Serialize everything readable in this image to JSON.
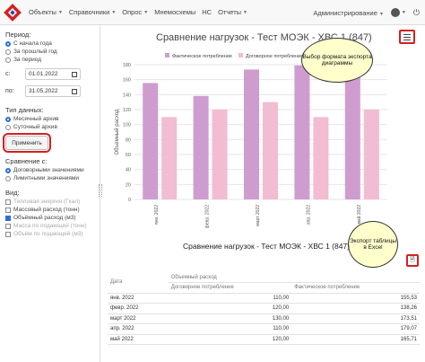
{
  "nav": {
    "items": [
      {
        "label": "Объекты",
        "caret": true
      },
      {
        "label": "Справочники",
        "caret": true
      },
      {
        "label": "Опрос",
        "caret": true
      },
      {
        "label": "Мнемосхемы",
        "caret": false
      },
      {
        "label": "НС",
        "caret": false
      },
      {
        "label": "Отчеты",
        "caret": true
      }
    ],
    "admin_label": "Администрирование"
  },
  "sidebar": {
    "period_title": "Период:",
    "period_options": [
      "С начала года",
      "За прошлый год",
      "За период"
    ],
    "period_selected": 0,
    "from_label": "с:",
    "from_value": "01.01.2022",
    "to_label": "по:",
    "to_value": "31.05.2022",
    "data_type_title": "Тип данных:",
    "data_type_options": [
      "Месячный архив",
      "Суточный архив"
    ],
    "data_type_selected": 0,
    "apply_label": "Применить",
    "compare_title": "Сравнение с:",
    "compare_options": [
      "Договорными значениями",
      "Лимитными значениями"
    ],
    "compare_selected": 0,
    "view_title": "Вид:",
    "view_options": [
      {
        "label": "Тепловая энергия (Гкал)",
        "checked": false,
        "disabled": true
      },
      {
        "label": "Массовый расход (тонн)",
        "checked": false,
        "disabled": false
      },
      {
        "label": "Объёмный расход (м3)",
        "checked": true,
        "disabled": false
      },
      {
        "label": "Масса по подающей (тонн)",
        "checked": false,
        "disabled": true
      },
      {
        "label": "Объём по подающей (м3)",
        "checked": false,
        "disabled": true
      }
    ]
  },
  "chart": {
    "title": "Сравнение нагрузок - Тест МОЭК - ХВС 1 (847)",
    "callout_menu": "Выбор формата экспорта диаграммы",
    "callout_excel": "Экспорт таблицы в Excel",
    "colors": {
      "actual": "#cf9ccf",
      "contract": "#f2bcd2"
    }
  },
  "chart_data": {
    "type": "bar",
    "title": "Сравнение нагрузок - Тест МОЭК - ХВС 1 (847)",
    "ylabel": "Объемный расход",
    "categories": [
      "янв. 2022",
      "февр. 2022",
      "март 2022",
      "апр. 2022",
      "май 2022"
    ],
    "series": [
      {
        "name": "Фактическое потребление",
        "values": [
          155.53,
          138.26,
          173.51,
          179.07,
          165.71
        ]
      },
      {
        "name": "Договорное потребление",
        "values": [
          110.0,
          120.0,
          130.0,
          110.0,
          120.0
        ]
      }
    ],
    "yticks": [
      0,
      20,
      40,
      60,
      80,
      100,
      120,
      140,
      160,
      180
    ],
    "ylim": [
      0,
      180
    ],
    "legend": "top",
    "grid": true
  },
  "table": {
    "title": "Сравнение нагрузок - Тест МОЭК - ХВС 1 (847)",
    "col_date": "Дата",
    "col_group": "Объемный расход",
    "col_contract": "Договорное потребление",
    "col_actual": "Фактическое потребление",
    "rows": [
      {
        "date": "янв. 2022",
        "contract": "110,00",
        "actual": "155,53"
      },
      {
        "date": "февр. 2022",
        "contract": "120,00",
        "actual": "138,26"
      },
      {
        "date": "март 2022",
        "contract": "130,00",
        "actual": "173,51"
      },
      {
        "date": "апр. 2022",
        "contract": "110,00",
        "actual": "179,07"
      },
      {
        "date": "май 2022",
        "contract": "120,00",
        "actual": "165,71"
      }
    ]
  }
}
